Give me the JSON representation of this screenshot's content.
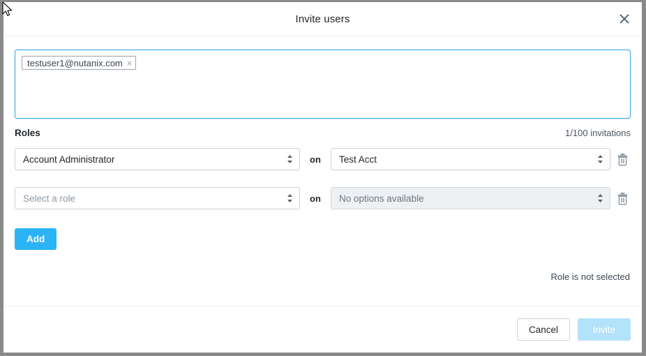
{
  "dialog": {
    "title": "Invite users",
    "close_icon": "close-icon"
  },
  "recipients": {
    "chips": [
      {
        "email": "testuser1@nutanix.com",
        "remove_icon": "×"
      }
    ]
  },
  "roles_section": {
    "label": "Roles",
    "invitation_counter": "1/100 invitations",
    "conjunction": "on",
    "rows": [
      {
        "role": "Account Administrator",
        "role_is_placeholder": false,
        "scope": "Test Acct",
        "scope_is_placeholder": false,
        "scope_disabled": false,
        "delete_icon": "trash-icon"
      },
      {
        "role": "Select a role",
        "role_is_placeholder": true,
        "scope": "No options available",
        "scope_is_placeholder": true,
        "scope_disabled": true,
        "delete_icon": "trash-icon"
      }
    ],
    "add_label": "Add",
    "validation_message": "Role is not selected"
  },
  "footer": {
    "cancel_label": "Cancel",
    "invite_label": "Invite"
  },
  "colors": {
    "accent_blue": "#2cb3f5",
    "focus_border": "#2f9fe0",
    "invite_disabled": "#b3e2fb",
    "text_primary": "#22272b",
    "text_muted": "#8c98a4",
    "border": "#ccd2d8",
    "page_frame": "#8a8a8a"
  }
}
